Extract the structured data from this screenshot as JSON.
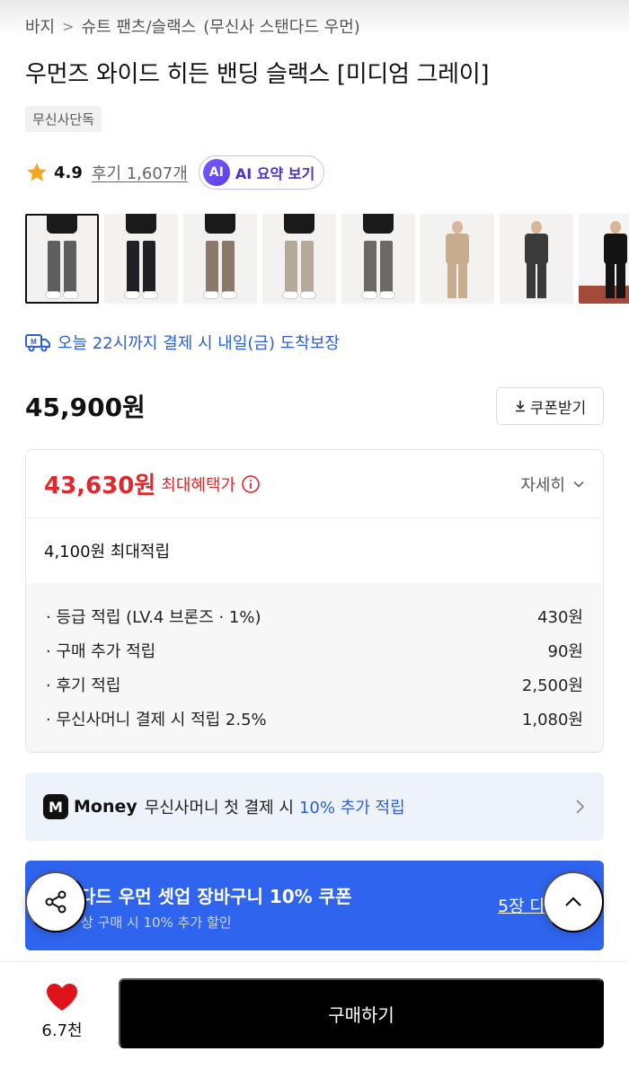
{
  "breadcrumb": {
    "items": [
      "바지",
      "슈트 팬츠/슬랙스",
      "(무신사 스탠다드 우먼)"
    ],
    "separator": ">"
  },
  "product": {
    "title": "우먼즈 와이드 히든 밴딩 슬랙스 [미디엄 그레이]",
    "exclusive_badge": "무신사단독",
    "rating": "4.9",
    "review_link": "후기 1,607개",
    "ai_summary": {
      "badge": "AI",
      "label": "AI 요약 보기"
    }
  },
  "thumbnails": [
    {
      "alt": "미디엄 그레이",
      "color": "#5f5f5f",
      "selected": true
    },
    {
      "alt": "블랙",
      "color": "#1f2127",
      "selected": false
    },
    {
      "alt": "브라운",
      "color": "#8a7a6c",
      "selected": false
    },
    {
      "alt": "베이지 그레이",
      "color": "#b4aa9c",
      "selected": false
    },
    {
      "alt": "그레이",
      "color": "#6b6965",
      "selected": false
    },
    {
      "alt": "셋업 베이지",
      "color": "#c7ad8d",
      "selected": false
    },
    {
      "alt": "다크 그레이",
      "color": "#3a3a3a",
      "selected": false
    },
    {
      "alt": "블랙 셋업",
      "color": "#141414",
      "selected": false
    }
  ],
  "delivery": {
    "icon": "delivery-truck-icon",
    "text": "오늘 22시까지 결제 시 내일(금) 도착보장"
  },
  "price": {
    "original": "45,900원",
    "coupon_button": "쿠폰받기"
  },
  "benefit": {
    "best_price": "43,630원",
    "best_label": "최대혜택가",
    "detail_toggle": "자세히",
    "points_total": "4,100원 최대적립",
    "points": [
      {
        "label": "· 등급 적립 (LV.4 브론즈 · 1%)",
        "value": "430원"
      },
      {
        "label": "· 구매 추가 적립",
        "value": "90원"
      },
      {
        "label": "· 후기 적립",
        "value": "2,500원"
      },
      {
        "label": "· 무신사머니 결제 시 적립 2.5%",
        "value": "1,080원"
      }
    ]
  },
  "money_banner": {
    "logo": "M",
    "brand": "Money",
    "text": "무신사머니 첫 결제 시",
    "highlight": "10% 추가 적립"
  },
  "coupon_banner": {
    "title": "다드 우먼 셋업 장바구니 10% 쿠폰",
    "subtitle": "상 구매 시 10% 추가 할인",
    "count_link": "5장 다"
  },
  "bottom_bar": {
    "like_count": "6.7천",
    "buy_button": "구매하기"
  },
  "colors": {
    "accent_red": "#e0272b",
    "link_blue": "#2b5fd9",
    "coupon_blue": "#2f64ef",
    "buy_black": "#000000"
  }
}
